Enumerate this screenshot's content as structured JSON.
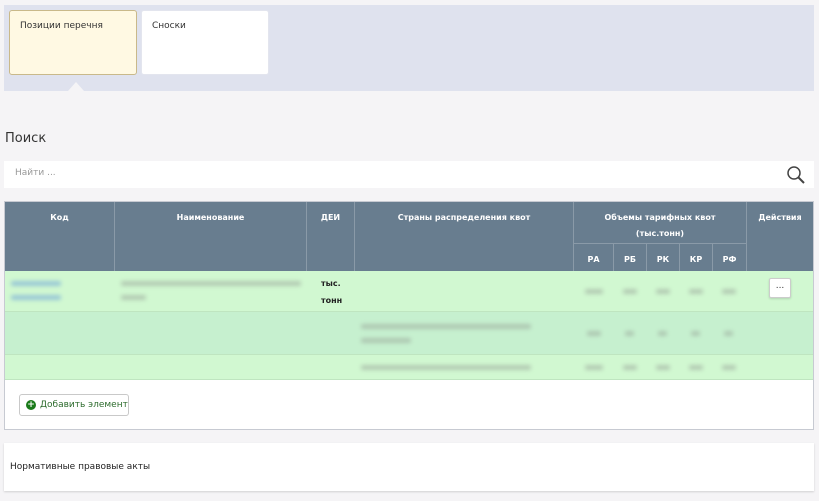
{
  "tabs": [
    {
      "label": "Позиции перечня",
      "active": true
    },
    {
      "label": "Сноски",
      "active": false
    }
  ],
  "search": {
    "title": "Поиск",
    "placeholder": "Найти ..."
  },
  "table": {
    "headers": {
      "code": "Код",
      "name": "Наименование",
      "dei": "ДЕИ",
      "countries": "Страны распределения квот",
      "volumes": "Объемы тарифных квот (тыс.тонн)",
      "actions": "Действия"
    },
    "subheaders": [
      "РА",
      "РБ",
      "РК",
      "КР",
      "РФ"
    ],
    "rows": [
      {
        "dei": "тыс. тонн",
        "action_label": "..."
      }
    ],
    "add_label": "Добавить элемент"
  },
  "npa": {
    "label": "Нормативные правовые акты"
  },
  "colors": {
    "header": "#687d8f",
    "row_green": "#d1f8d1",
    "row_green_alt": "#c6f0cf",
    "tab_active": "#fff9e3"
  }
}
